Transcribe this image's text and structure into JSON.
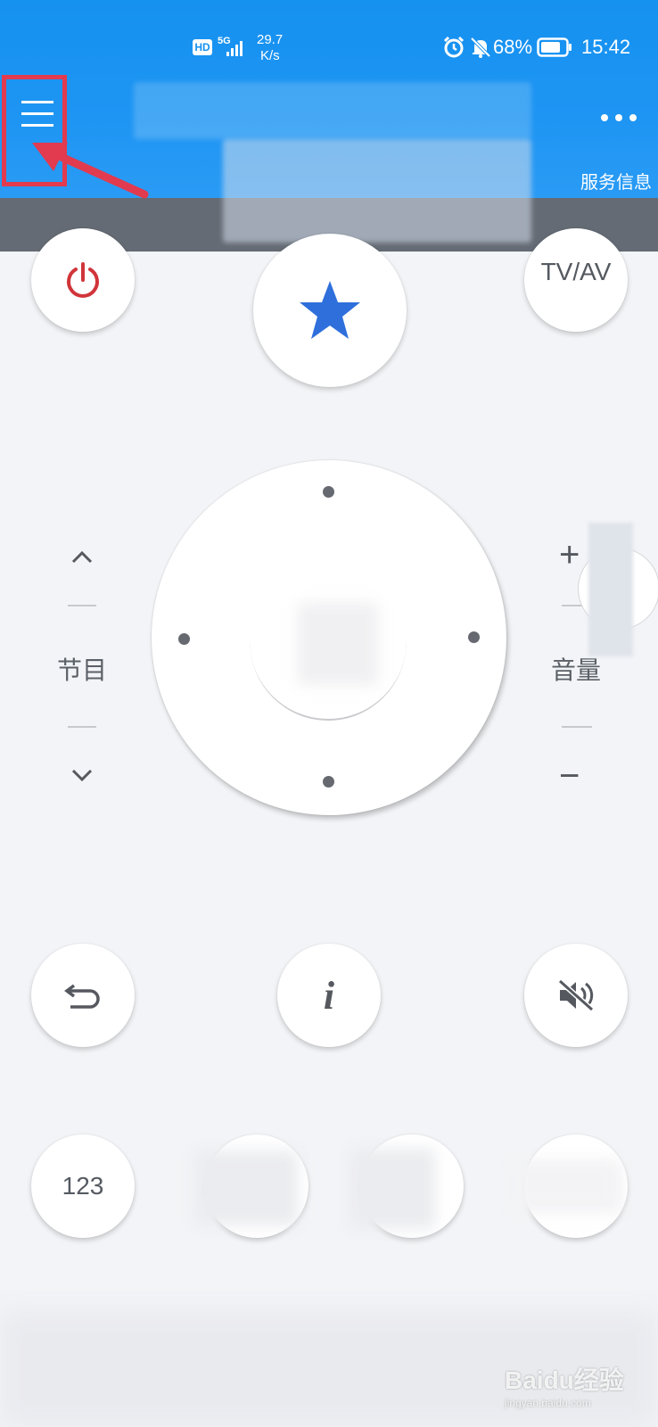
{
  "status_bar": {
    "hd_badge": "HD",
    "network": "5G",
    "speed_value": "29.7",
    "speed_unit": "K/s",
    "battery_percent": "68%",
    "time": "15:42"
  },
  "header": {
    "menu_icon": "hamburger-menu-icon",
    "more_icon": "more-dots-icon",
    "service_info_label": "服务信息"
  },
  "remote": {
    "power_icon": "power-icon",
    "favorite_icon": "star-icon",
    "tv_av_label": "TV/AV",
    "channel_label": "节目",
    "volume_label": "音量",
    "volume_plus": "+",
    "volume_minus": "−",
    "back_icon": "back-arrow-icon",
    "info_label": "i",
    "mute_icon": "mute-icon",
    "numpad_label": "123"
  },
  "colors": {
    "header_blue": "#1591f0",
    "subbar_gray": "#646b74",
    "power_red": "#d0353a",
    "star_blue": "#2f6fdc",
    "annotation_red": "#e23a4e"
  },
  "watermark": {
    "text": "Baidu经验",
    "sub": "jingyan.baidu.com"
  }
}
